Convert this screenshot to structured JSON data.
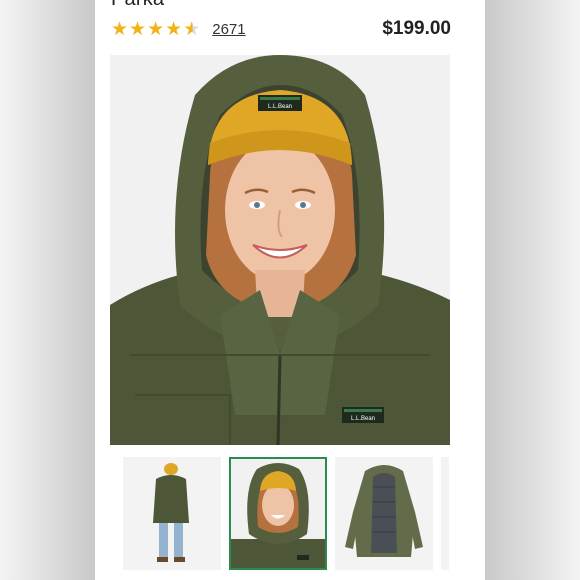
{
  "product": {
    "title_partial": "Parka",
    "rating": 4.5,
    "review_count": "2671",
    "price": "$199.00"
  },
  "stars": {
    "icons": [
      "star-filled",
      "star-filled",
      "star-filled",
      "star-filled",
      "star-half"
    ],
    "color": "#f0b418"
  },
  "main_image": {
    "subject": "woman in olive green hooded parka and mustard beanie",
    "hat_patch_text": "L.L.Bean",
    "chest_patch_text": "L.L.Bean"
  },
  "thumbnails": {
    "selected_index": 1,
    "selected_border_color": "#2d8a4e",
    "items": [
      "back-view",
      "hood-closeup",
      "interior-view",
      "partial"
    ]
  },
  "colors": {
    "jacket": "#505a3a",
    "beanie": "#e0a726"
  }
}
